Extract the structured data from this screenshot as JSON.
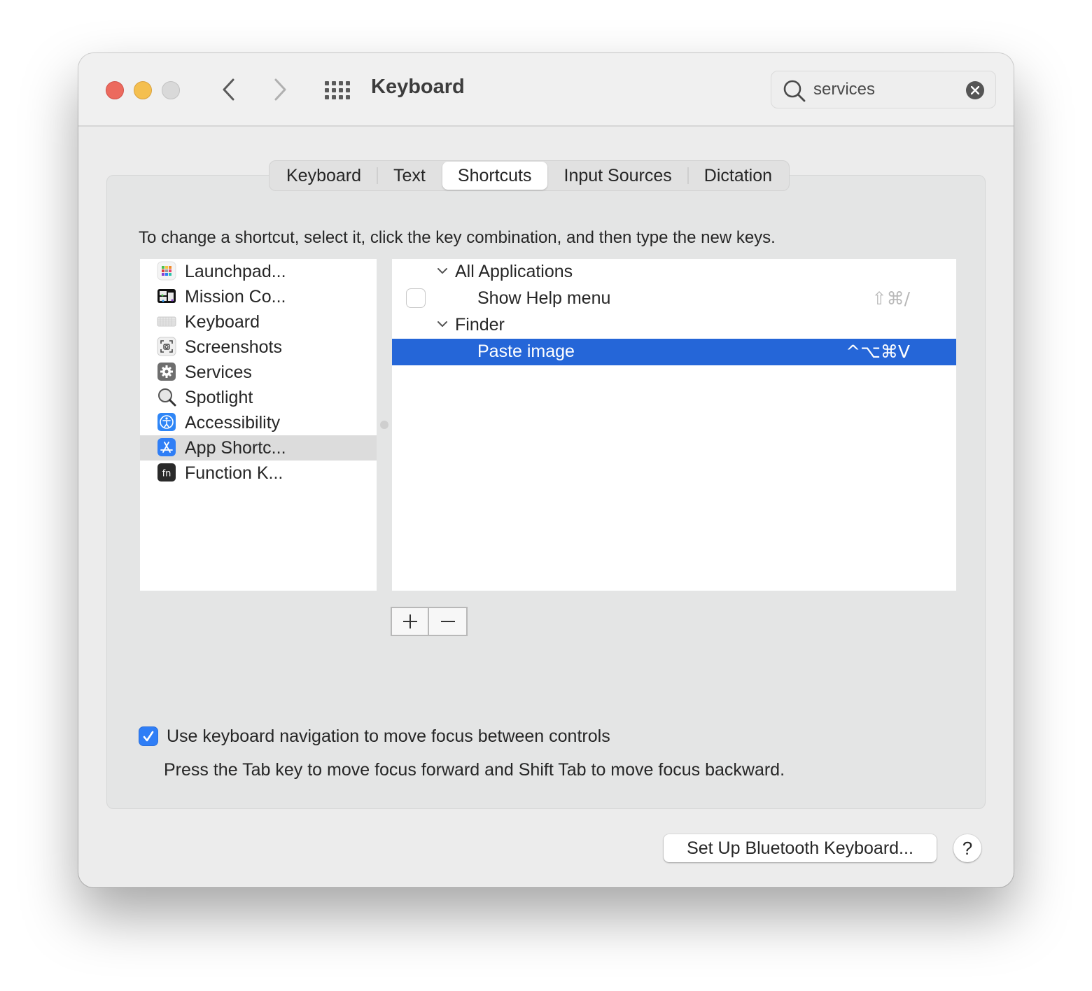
{
  "window": {
    "title": "Keyboard",
    "traffic_lights": {
      "close_color": "#ec6a5e",
      "minimize_color": "#f4bf4f",
      "zoom_color": "#d9d9d9"
    }
  },
  "toolbar": {
    "back_icon": "chevron-left-icon",
    "forward_icon": "chevron-right-icon",
    "show_all_icon": "grid-icon"
  },
  "search": {
    "value": "services",
    "placeholder": "Search",
    "icon": "magnifier-icon",
    "clear_icon": "clear-icon"
  },
  "tabs": [
    {
      "label": "Keyboard",
      "active": false
    },
    {
      "label": "Text",
      "active": false
    },
    {
      "label": "Shortcuts",
      "active": true
    },
    {
      "label": "Input Sources",
      "active": false
    },
    {
      "label": "Dictation",
      "active": false
    }
  ],
  "instructions": "To change a shortcut, select it, click the key combination, and then type the new keys.",
  "categories": [
    {
      "label": "Launchpad...",
      "icon": "launchpad-icon",
      "selected": false
    },
    {
      "label": "Mission Co...",
      "icon": "mission-control-icon",
      "selected": false
    },
    {
      "label": "Keyboard",
      "icon": "keyboard-icon",
      "selected": false
    },
    {
      "label": "Screenshots",
      "icon": "screenshot-icon",
      "selected": false
    },
    {
      "label": "Services",
      "icon": "gear-icon",
      "selected": false
    },
    {
      "label": "Spotlight",
      "icon": "spotlight-icon",
      "selected": false
    },
    {
      "label": "Accessibility",
      "icon": "accessibility-icon",
      "selected": false
    },
    {
      "label": "App Shortc...",
      "icon": "app-store-icon",
      "selected": true
    },
    {
      "label": "Function K...",
      "icon": "fn-icon",
      "selected": false
    }
  ],
  "shortcuts": [
    {
      "type": "group",
      "label": "All Applications",
      "expanded": true
    },
    {
      "type": "item",
      "label": "Show Help menu",
      "keys": "⇧⌘/",
      "checkbox": true,
      "checked": false,
      "dim": true,
      "selected": false
    },
    {
      "type": "group",
      "label": "Finder",
      "expanded": true
    },
    {
      "type": "item",
      "label": "Paste image",
      "keys": "^⌥⌘V",
      "checkbox": false,
      "dim": false,
      "selected": true
    }
  ],
  "list_buttons": {
    "add": "+",
    "remove": "−"
  },
  "keyboard_navigation": {
    "checked": true,
    "label": "Use keyboard navigation to move focus between controls",
    "help": "Press the Tab key to move focus forward and Shift Tab to move focus backward."
  },
  "footer": {
    "bluetooth_button": "Set Up Bluetooth Keyboard...",
    "help_button": "?"
  },
  "colors": {
    "selection": "#2566d8",
    "checkbox_accent": "#2f7ef6"
  }
}
